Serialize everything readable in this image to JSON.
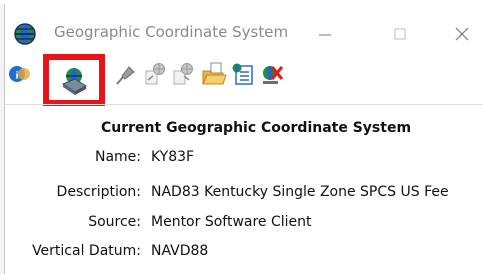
{
  "window": {
    "title": "Geographic Coordinate System",
    "controls": {
      "minimize": "minimize-icon",
      "maximize": "maximize-icon",
      "close": "close-icon"
    }
  },
  "toolbar": {
    "buttons": [
      {
        "name": "info-icon",
        "selected": false
      },
      {
        "name": "globe-database-icon",
        "selected": true
      },
      {
        "name": "pushpin-icon",
        "selected": false
      },
      {
        "name": "globe-export-icon",
        "selected": false
      },
      {
        "name": "globe-import-icon",
        "selected": false
      },
      {
        "name": "open-folder-icon",
        "selected": false
      },
      {
        "name": "list-globe-icon",
        "selected": false
      },
      {
        "name": "delete-globe-icon",
        "selected": false
      }
    ],
    "highlight_color": "#e8141a"
  },
  "panel": {
    "heading": "Current Geographic Coordinate System",
    "fields": [
      {
        "label": "Name:",
        "value": "KY83F"
      },
      {
        "label": "Description:",
        "value": "NAD83 Kentucky Single Zone SPCS US Fee"
      },
      {
        "label": "Source:",
        "value": "Mentor Software Client"
      },
      {
        "label": "Vertical Datum:",
        "value": "NAVD88"
      }
    ]
  }
}
